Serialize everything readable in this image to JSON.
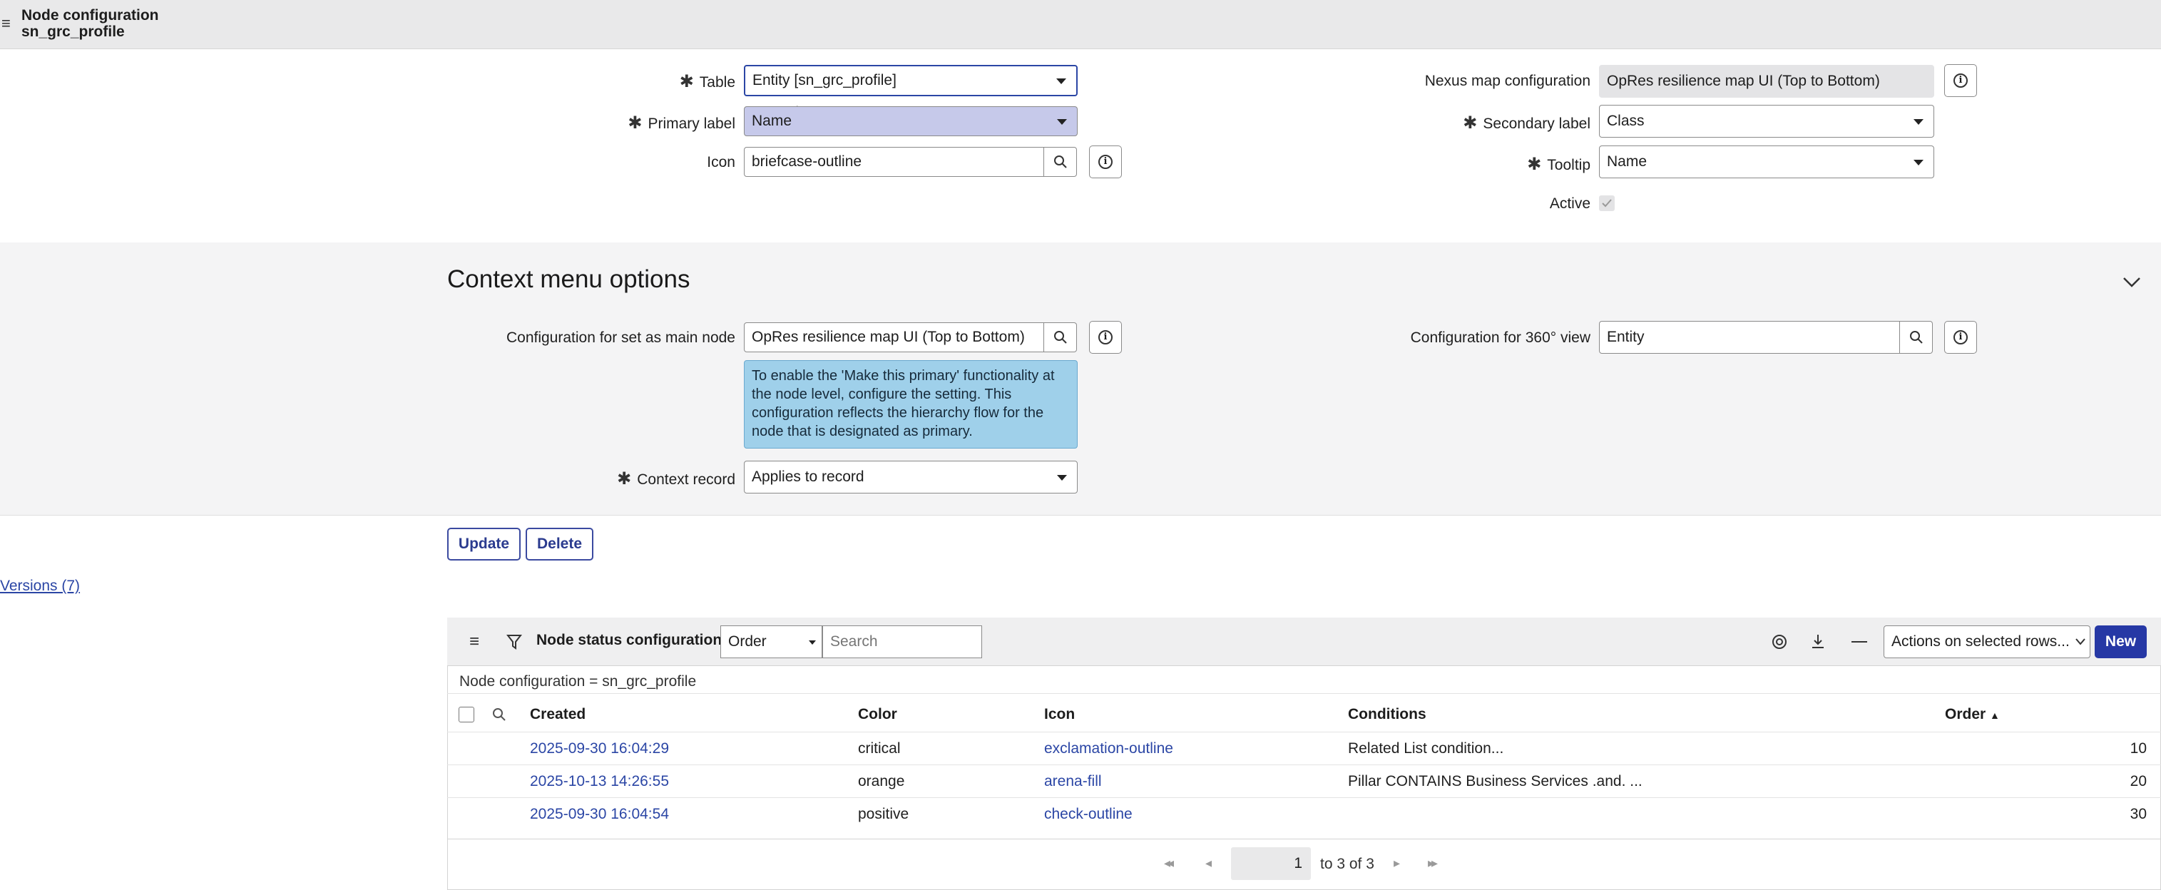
{
  "header": {
    "title": "Node configuration",
    "subtitle": "sn_grc_profile"
  },
  "form": {
    "table_label": "Table",
    "table_value": "Entity [sn_grc_profile]",
    "primary_label": "Primary label",
    "primary_value": "Name",
    "icon_label": "Icon",
    "icon_value": "briefcase-outline",
    "nexus_label": "Nexus map configuration",
    "nexus_value": "OpRes resilience map UI (Top to Bottom)",
    "secondary_label": "Secondary label",
    "secondary_value": "Class",
    "tooltip_label": "Tooltip",
    "tooltip_value": "Name",
    "active_label": "Active",
    "active_checked": true
  },
  "context_menu": {
    "title": "Context menu options",
    "main_node_label": "Configuration for set as main node",
    "main_node_value": "OpRes resilience map UI (Top to Bottom)",
    "tip_text": "To enable the 'Make this primary' functionality at the node level, configure the setting. This configuration reflects the hierarchy flow for the node that is designated as primary.",
    "view360_label": "Configuration for 360° view",
    "view360_value": "Entity",
    "context_record_label": "Context record",
    "context_record_value": "Applies to record"
  },
  "actions": {
    "update": "Update",
    "delete": "Delete",
    "versions": "Versions (7)"
  },
  "related_list": {
    "title": "Node status configurations",
    "sort_field": "Order",
    "search_placeholder": "Search",
    "actions_select": "Actions on selected rows...",
    "new_button": "New",
    "condition": "Node configuration = sn_grc_profile",
    "columns": [
      "Created",
      "Color",
      "Icon",
      "Conditions",
      "Order"
    ],
    "rows": [
      {
        "created": "2025-09-30 16:04:29",
        "color": "critical",
        "icon": "exclamation-outline",
        "conditions": "Related List condition...",
        "order": "10"
      },
      {
        "created": "2025-10-13 14:26:55",
        "color": "orange",
        "icon": "arena-fill",
        "conditions": "Pillar CONTAINS Business Services .and. ...",
        "order": "20"
      },
      {
        "created": "2025-09-30 16:04:54",
        "color": "positive",
        "icon": "check-outline",
        "conditions": "",
        "order": "30"
      }
    ],
    "pager_value": "1",
    "pager_text": "to 3 of 3"
  },
  "colors": {
    "accent": "#2638a5",
    "link": "#2b46a5",
    "tip_bg": "#9fd0ea",
    "highlight": "#c6c9ea"
  }
}
